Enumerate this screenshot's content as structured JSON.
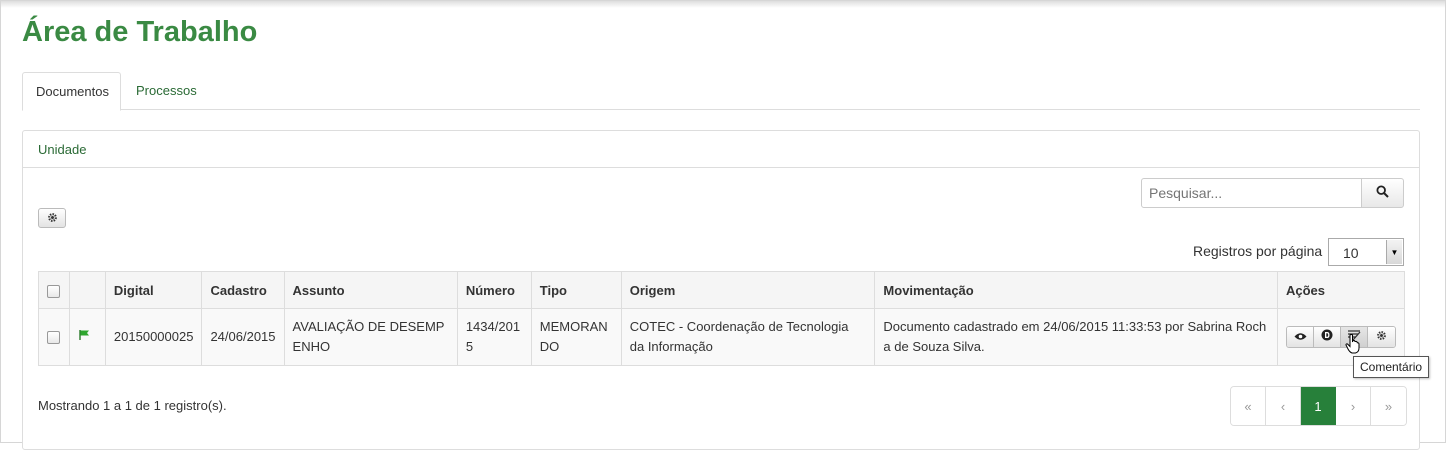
{
  "page": {
    "title": "Área de Trabalho"
  },
  "tabs": [
    {
      "label": "Documentos",
      "active": true
    },
    {
      "label": "Processos",
      "active": false
    }
  ],
  "panel": {
    "heading": "Unidade"
  },
  "search": {
    "placeholder": "Pesquisar..."
  },
  "records_per_page": {
    "label": "Registros por página",
    "value": "10"
  },
  "table": {
    "columns": [
      "Digital",
      "Cadastro",
      "Assunto",
      "Número",
      "Tipo",
      "Origem",
      "Movimentação",
      "Ações"
    ],
    "rows": [
      {
        "digital": "20150000025",
        "cadastro": "24/06/2015",
        "assunto": "AVALIAÇÃO DE DESEMP ENHO",
        "numero": "1434/201 5",
        "tipo": "MEMORAN DO",
        "origem": "COTEC - Coordenação de Tecnologia da Informação",
        "movimentacao": "Documento cadastrado em 24/06/2015 11:33:53 por Sabrina Roch a de Souza Silva."
      }
    ]
  },
  "tooltip": {
    "text": "Comentário"
  },
  "footer": {
    "showing": "Mostrando 1 a 1 de 1 registro(s)."
  },
  "pagination": {
    "first": "«",
    "prev": "‹",
    "current": "1",
    "next": "›",
    "last": "»"
  },
  "colors": {
    "title_green": "#3a8a43",
    "active_page": "#27803a",
    "flag": "#2ea62e"
  }
}
